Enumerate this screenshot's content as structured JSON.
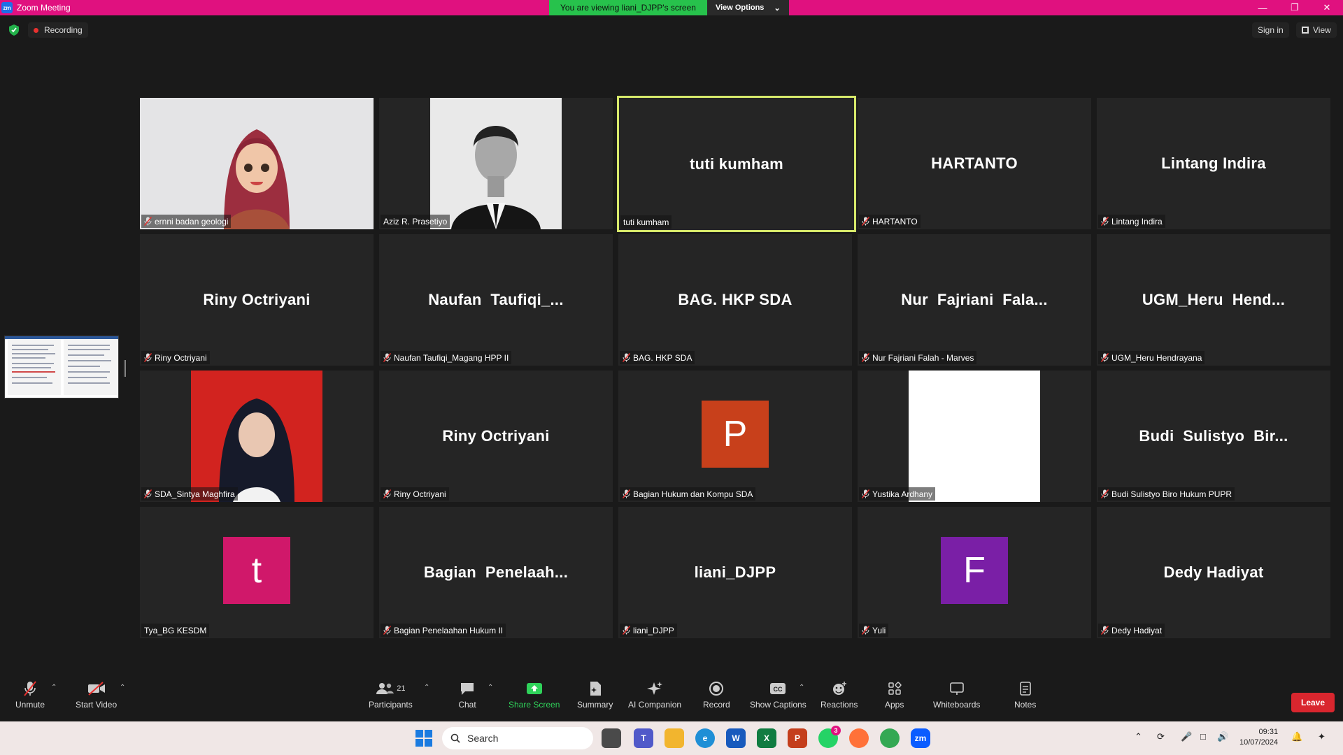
{
  "titlebar": {
    "app_title": "Zoom Meeting",
    "app_logo": "zm"
  },
  "share_banner": {
    "viewing_text": "You are viewing liani_DJPP's screen",
    "view_options_label": "View Options"
  },
  "subbar": {
    "recording_label": "Recording",
    "sign_in_label": "Sign in",
    "view_label": "View"
  },
  "tiles": [
    {
      "big_name": "",
      "label": "ernni badan geologi",
      "muted": true
    },
    {
      "big_name": "",
      "label": "Aziz R. Prasetiyo",
      "muted": false
    },
    {
      "big_name": "tuti kumham",
      "label": "tuti kumham",
      "muted": false
    },
    {
      "big_name": "HARTANTO",
      "label": "HARTANTO",
      "muted": true
    },
    {
      "big_name": "Lintang Indira",
      "label": "Lintang Indira",
      "muted": true
    },
    {
      "big_name": "Riny Octriyani",
      "label": "Riny Octriyani",
      "muted": true
    },
    {
      "big_name": "Naufan  Taufiqi_...",
      "label": "Naufan Taufiqi_Magang HPP II",
      "muted": true
    },
    {
      "big_name": "BAG. HKP SDA",
      "label": "BAG. HKP SDA",
      "muted": true
    },
    {
      "big_name": "Nur  Fajriani  Fala...",
      "label": "Nur Fajriani Falah - Marves",
      "muted": true
    },
    {
      "big_name": "UGM_Heru  Hend...",
      "label": "UGM_Heru Hendrayana",
      "muted": true
    },
    {
      "big_name": "",
      "label": "SDA_Sintya Maghfira",
      "muted": true
    },
    {
      "big_name": "Riny Octriyani",
      "label": "Riny Octriyani",
      "muted": true
    },
    {
      "big_name": "",
      "label": "Bagian Hukum dan Kompu SDA",
      "muted": true,
      "avatar": "P"
    },
    {
      "big_name": "",
      "label": "Yustika Ardhany",
      "muted": true
    },
    {
      "big_name": "Budi  Sulistyo  Bir...",
      "label": "Budi Sulistyo Biro Hukum PUPR",
      "muted": true
    },
    {
      "big_name": "",
      "label": "Tya_BG KESDM",
      "muted": false,
      "avatar": "t"
    },
    {
      "big_name": "Bagian  Penelaah...",
      "label": "Bagian Penelaahan Hukum II",
      "muted": true
    },
    {
      "big_name": "liani_DJPP",
      "label": "liani_DJPP",
      "muted": true
    },
    {
      "big_name": "",
      "label": "Yuli",
      "muted": true,
      "avatar": "F"
    },
    {
      "big_name": "Dedy Hadiyat",
      "label": "Dedy Hadiyat",
      "muted": true
    }
  ],
  "colors": {
    "active_speaker_border": "#d6e86a",
    "avatar_p": "#c8401b",
    "avatar_t": "#d0186a",
    "avatar_f": "#7a1fa6",
    "leave": "#d9262e",
    "share_screen": "#2fd25a"
  },
  "toolbar": {
    "unmute": "Unmute",
    "start_video": "Start Video",
    "participants": "Participants",
    "participants_count": "21",
    "chat": "Chat",
    "share_screen": "Share Screen",
    "summary": "Summary",
    "ai_companion": "AI Companion",
    "record": "Record",
    "show_captions": "Show Captions",
    "reactions": "Reactions",
    "apps": "Apps",
    "whiteboards": "Whiteboards",
    "notes": "Notes",
    "leave": "Leave"
  },
  "taskbar": {
    "search_label": "Search",
    "whatsapp_badge": "3",
    "time": "09:31",
    "date": "10/07/2024"
  }
}
